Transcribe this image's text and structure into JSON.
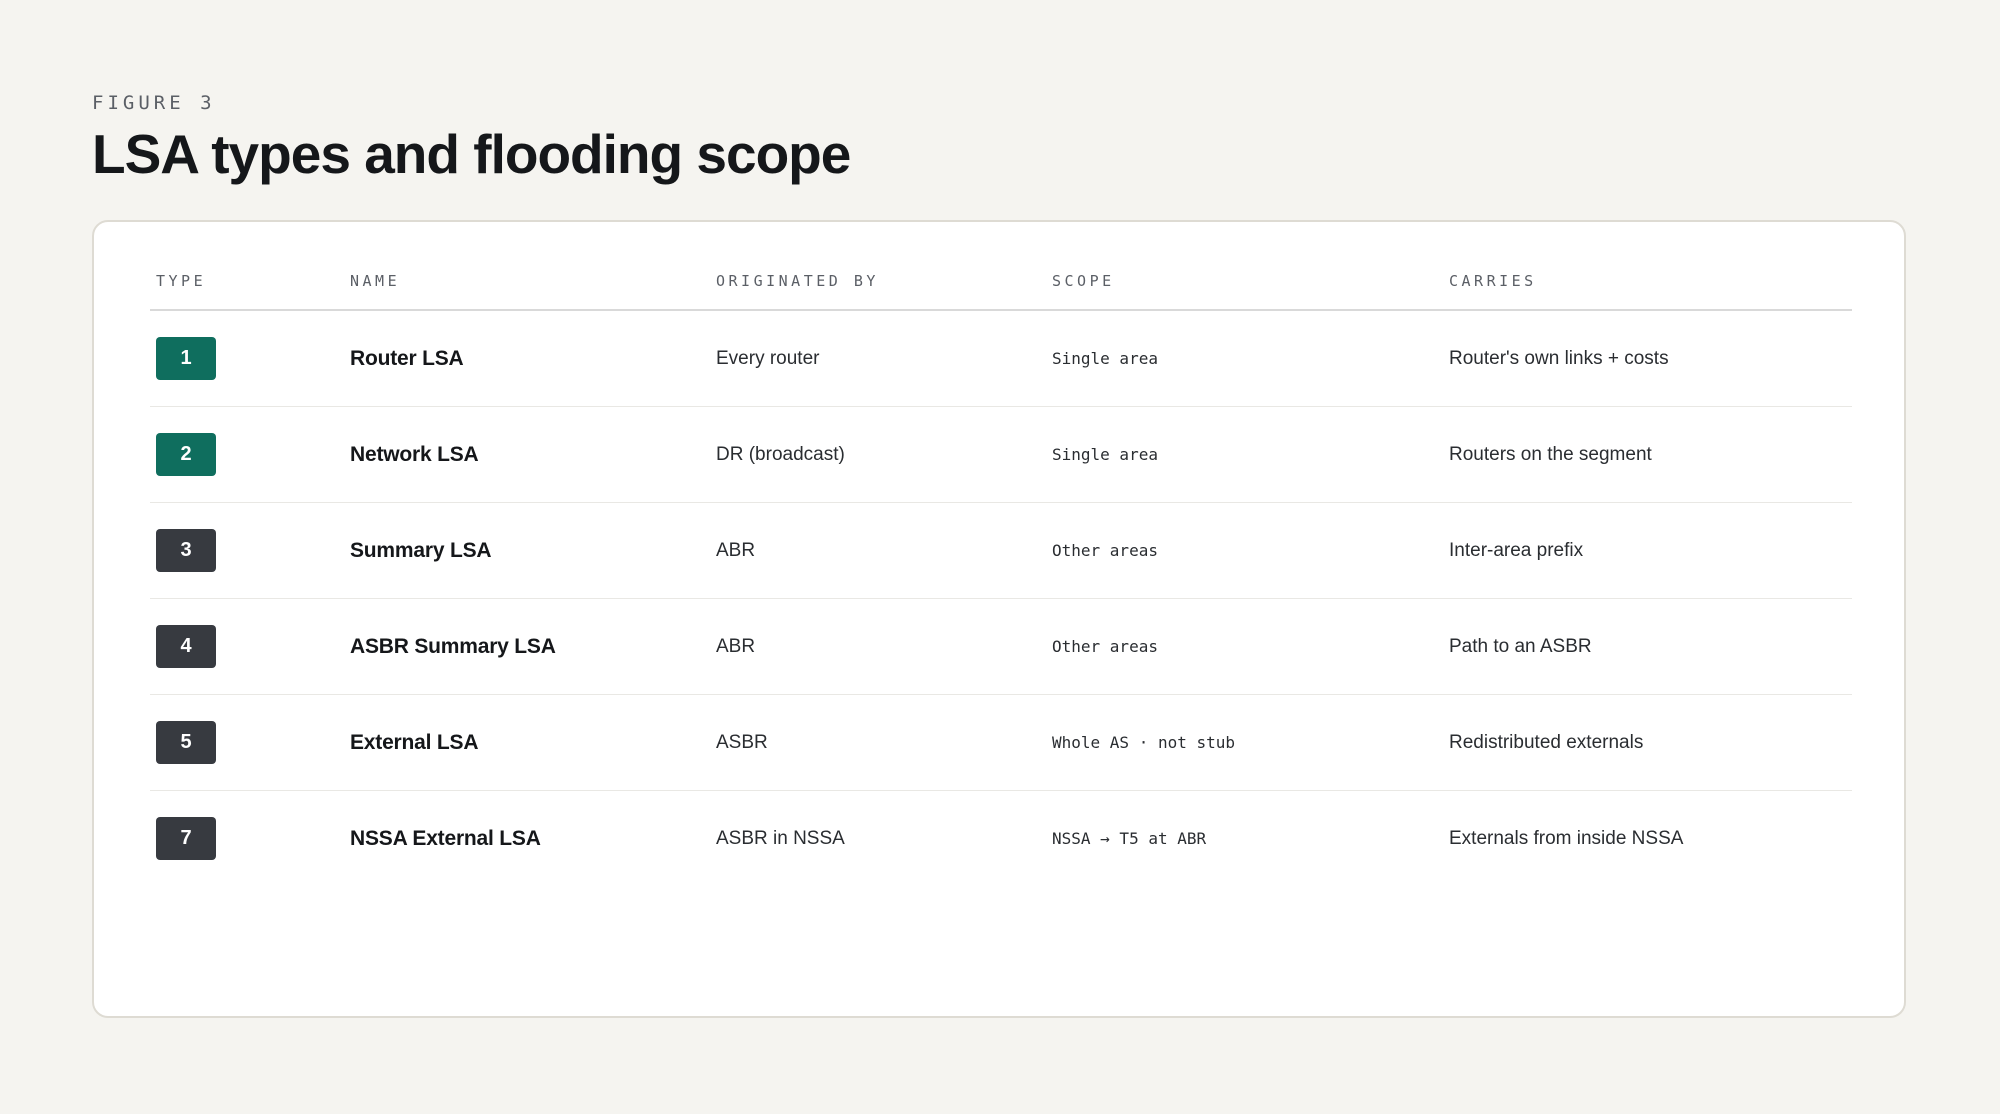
{
  "figure": {
    "eyebrow": "FIGURE 3",
    "title": "LSA types and flooding scope"
  },
  "colors": {
    "page_background": "#f5f4f0",
    "badge_local": "#0f6e5e",
    "badge_wide": "#373a40"
  },
  "table": {
    "headers": {
      "type": "TYPE",
      "name": "NAME",
      "originated_by": "ORIGINATED BY",
      "scope": "SCOPE",
      "carries": "CARRIES"
    },
    "rows": [
      {
        "type": "1",
        "name": "Router LSA",
        "originated_by": "Every router",
        "scope": "Single area",
        "carries": "Router's own links + costs",
        "badge_color": "#0f6e5e"
      },
      {
        "type": "2",
        "name": "Network LSA",
        "originated_by": "DR (broadcast)",
        "scope": "Single area",
        "carries": "Routers on the segment",
        "badge_color": "#0f6e5e"
      },
      {
        "type": "3",
        "name": "Summary LSA",
        "originated_by": "ABR",
        "scope": "Other areas",
        "carries": "Inter-area prefix",
        "badge_color": "#373a40"
      },
      {
        "type": "4",
        "name": "ASBR Summary LSA",
        "originated_by": "ABR",
        "scope": "Other areas",
        "carries": "Path to an ASBR",
        "badge_color": "#373a40"
      },
      {
        "type": "5",
        "name": "External LSA",
        "originated_by": "ASBR",
        "scope": "Whole AS · not stub",
        "carries": "Redistributed externals",
        "badge_color": "#373a40"
      },
      {
        "type": "7",
        "name": "NSSA External LSA",
        "originated_by": "ASBR in NSSA",
        "scope": "NSSA → T5 at ABR",
        "carries": "Externals from inside NSSA",
        "badge_color": "#373a40"
      }
    ]
  }
}
